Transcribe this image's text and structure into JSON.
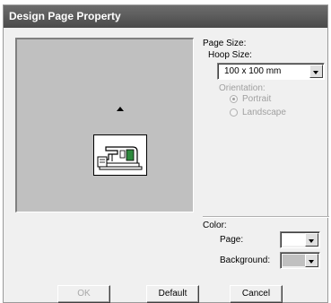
{
  "window": {
    "title": "Design Page Property"
  },
  "page_size": {
    "heading": "Page Size:",
    "hoop_label": "Hoop Size:",
    "hoop_value": "100 x 100 mm",
    "orientation_label": "Orientation:",
    "portrait_label": "Portrait",
    "landscape_label": "Landscape",
    "orientation_selected": "Portrait"
  },
  "color": {
    "heading": "Color:",
    "page_label": "Page:",
    "page_color": "#ffffff",
    "background_label": "Background:",
    "background_color": "#c0c0c0"
  },
  "buttons": {
    "ok": "OK",
    "default": "Default",
    "cancel": "Cancel"
  },
  "preview": {
    "canvas_color": "#c0c0c0",
    "icon": "sewing-machine-icon"
  }
}
